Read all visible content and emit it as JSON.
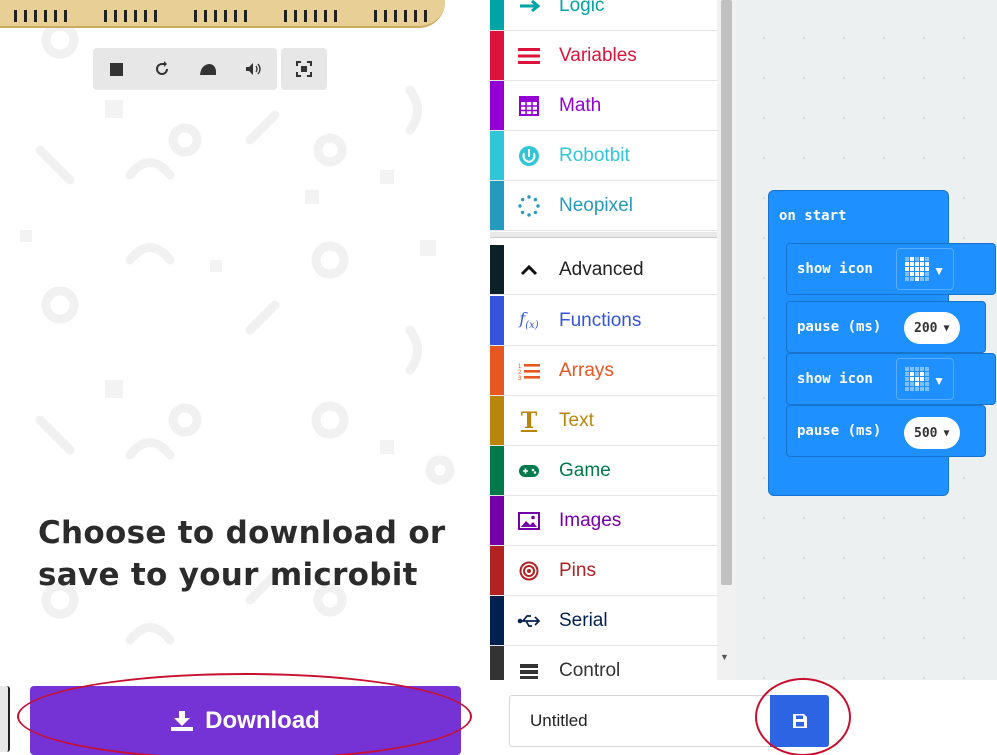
{
  "simulator": {
    "toolbar": [
      "stop-icon",
      "restart-icon",
      "slowmo-icon",
      "mute-icon",
      "fullscreen-icon"
    ],
    "message": "Choose to download or save to your microbit"
  },
  "toolbox": {
    "categories": [
      {
        "label": "Logic",
        "color": "#00a4a6",
        "icon": "logic-icon"
      },
      {
        "label": "Variables",
        "color": "#dc143c",
        "icon": "variables-icon"
      },
      {
        "label": "Math",
        "color": "#9400d3",
        "icon": "math-icon"
      },
      {
        "label": "Robotbit",
        "color": "#31c6d7",
        "icon": "robotbit-icon"
      },
      {
        "label": "Neopixel",
        "color": "#2699bf",
        "icon": "neopixel-icon"
      },
      {
        "label": "Advanced",
        "color": "#0b2027",
        "icon": "chevron-up-icon"
      },
      {
        "label": "Functions",
        "color": "#3455db",
        "icon": "functions-icon"
      },
      {
        "label": "Arrays",
        "color": "#e65722",
        "icon": "arrays-icon"
      },
      {
        "label": "Text",
        "color": "#b8860b",
        "icon": "text-icon"
      },
      {
        "label": "Game",
        "color": "#007a4b",
        "icon": "game-icon"
      },
      {
        "label": "Images",
        "color": "#7600a8",
        "icon": "images-icon"
      },
      {
        "label": "Pins",
        "color": "#b22222",
        "icon": "pins-icon"
      },
      {
        "label": "Serial",
        "color": "#002050",
        "icon": "serial-icon"
      },
      {
        "label": "Control",
        "color": "#333333",
        "icon": "control-icon"
      }
    ]
  },
  "workspace": {
    "event_label": "on start",
    "blocks": [
      {
        "label": "show icon",
        "kind": "icon"
      },
      {
        "label": "pause (ms)",
        "kind": "number",
        "value": "200"
      },
      {
        "label": "show icon",
        "kind": "icon"
      },
      {
        "label": "pause (ms)",
        "kind": "number",
        "value": "500"
      }
    ]
  },
  "bottom": {
    "download_label": "Download",
    "project_name": "Untitled",
    "accent_download": "#7532d5",
    "accent_save": "#2c64e3"
  }
}
